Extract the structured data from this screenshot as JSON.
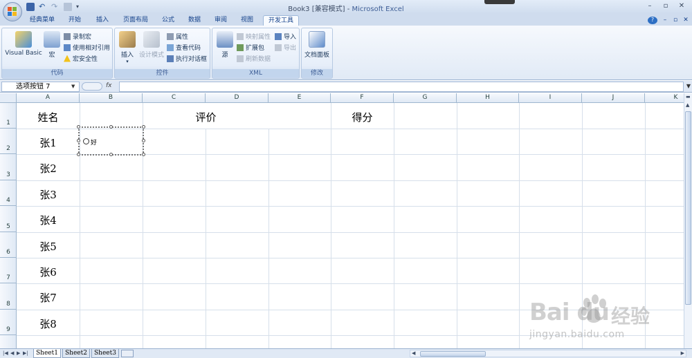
{
  "window": {
    "title": "Book3  [兼容模式] - ",
    "app_name": "Microsoft Excel",
    "controls": [
      "–",
      "▫",
      "✕"
    ],
    "ribbon_controls": [
      "?",
      "–",
      "▫",
      "✕"
    ]
  },
  "tabs": [
    {
      "label": "经典菜单"
    },
    {
      "label": "开始"
    },
    {
      "label": "插入"
    },
    {
      "label": "页面布局"
    },
    {
      "label": "公式"
    },
    {
      "label": "数据"
    },
    {
      "label": "审阅"
    },
    {
      "label": "视图"
    },
    {
      "label": "开发工具",
      "active": true
    }
  ],
  "ribbon": {
    "code": {
      "label": "代码",
      "visual_basic": "Visual Basic",
      "macro": "宏",
      "record_macro": "录制宏",
      "relative_ref": "使用相对引用",
      "macro_security": "宏安全性"
    },
    "controls": {
      "label": "控件",
      "insert": "插入",
      "design_mode": "设计模式",
      "properties": "属性",
      "view_code": "查看代码",
      "run_dialog": "执行对话框"
    },
    "xml": {
      "label": "XML",
      "source": "源",
      "map_properties": "映射属性",
      "expansion_packs": "扩展包",
      "refresh_data": "刷新数据",
      "import": "导入",
      "export": "导出"
    },
    "modify": {
      "label": "修改",
      "doc_panel": "文档面板"
    }
  },
  "formula_bar": {
    "name_box": "选项按钮 7",
    "fx": "fx",
    "formula": ""
  },
  "grid": {
    "columns": [
      "A",
      "B",
      "C",
      "D",
      "E",
      "F",
      "G",
      "H",
      "I",
      "J",
      "K"
    ],
    "rows": [
      "1",
      "2",
      "3",
      "4",
      "5",
      "6",
      "7",
      "8",
      "9"
    ],
    "cells": {
      "A1": "姓名",
      "C1": "评价",
      "F1": "得分",
      "A2": "张1",
      "A3": "张2",
      "A4": "张3",
      "A5": "张4",
      "A6": "张5",
      "A7": "张6",
      "A8": "张7",
      "A9": "张8"
    },
    "radio_label": "好"
  },
  "sheets": [
    {
      "name": "Sheet1",
      "active": true
    },
    {
      "name": "Sheet2"
    },
    {
      "name": "Sheet3"
    }
  ],
  "watermark": {
    "brand": "Bai du",
    "cn": "经验",
    "url": "jingyan.baidu.com"
  }
}
